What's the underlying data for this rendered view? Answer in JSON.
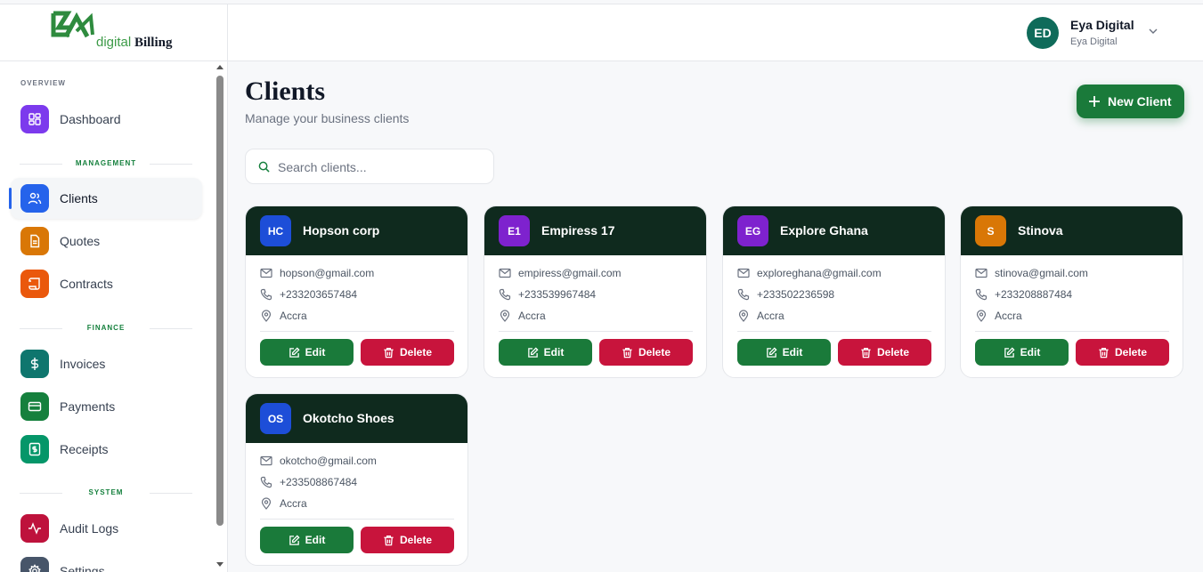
{
  "app": {
    "logo_word1": "digital",
    "logo_word2": "Billing",
    "brand_color": "#1a7a3a"
  },
  "user": {
    "initials": "ED",
    "name": "Eya Digital",
    "org": "Eya Digital"
  },
  "sidebar": {
    "sections": {
      "overview": "OVERVIEW",
      "management": "MANAGEMENT",
      "finance": "FINANCE",
      "system": "SYSTEM"
    },
    "items": [
      {
        "label": "Dashboard",
        "icon": "grid-icon",
        "color": "#7c3aed"
      },
      {
        "label": "Clients",
        "icon": "users-icon",
        "color": "#2563eb",
        "active": true
      },
      {
        "label": "Quotes",
        "icon": "document-icon",
        "color": "#d97706"
      },
      {
        "label": "Contracts",
        "icon": "scroll-icon",
        "color": "#ea580c"
      },
      {
        "label": "Invoices",
        "icon": "dollar-icon",
        "color": "#0f766e"
      },
      {
        "label": "Payments",
        "icon": "credit-card-icon",
        "color": "#15803d"
      },
      {
        "label": "Receipts",
        "icon": "receipt-icon",
        "color": "#059669"
      },
      {
        "label": "Audit Logs",
        "icon": "activity-icon",
        "color": "#be123c"
      },
      {
        "label": "Settings",
        "icon": "gear-icon",
        "color": "#475569"
      }
    ]
  },
  "page": {
    "title": "Clients",
    "subtitle": "Manage your business clients",
    "new_button": "New Client",
    "search_placeholder": "Search clients..."
  },
  "clients": [
    {
      "initials": "HC",
      "name": "Hopson corp",
      "email": "hopson@gmail.com",
      "phone": "+233203657484",
      "location": "Accra",
      "color": "#1d4ed8"
    },
    {
      "initials": "E1",
      "name": "Empiress 17",
      "email": "empiress@gmail.com",
      "phone": "+233539967484",
      "location": "Accra",
      "color": "#7e22ce"
    },
    {
      "initials": "EG",
      "name": "Explore Ghana",
      "email": "exploreghana@gmail.com",
      "phone": "+233502236598",
      "location": "Accra",
      "color": "#7e22ce"
    },
    {
      "initials": "S",
      "name": "Stinova",
      "email": "stinova@gmail.com",
      "phone": "+233208887484",
      "location": "Accra",
      "color": "#d97706"
    },
    {
      "initials": "OS",
      "name": "Okotcho Shoes",
      "email": "okotcho@gmail.com",
      "phone": "+233508867484",
      "location": "Accra",
      "color": "#1d4ed8"
    }
  ],
  "card_actions": {
    "edit": "Edit",
    "delete": "Delete"
  }
}
